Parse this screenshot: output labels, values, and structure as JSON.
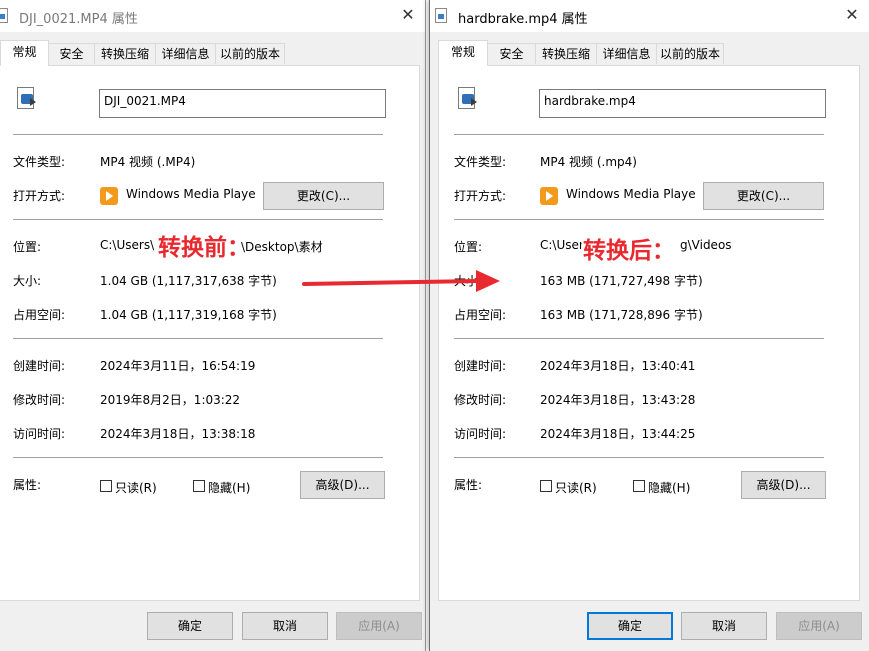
{
  "left": {
    "title": "DJI_0021.MP4 属性",
    "tabs": [
      "常规",
      "安全",
      "转换压缩",
      "详细信息",
      "以前的版本"
    ],
    "filename": "DJI_0021.MP4",
    "labels": {
      "file_type": "文件类型:",
      "open_with": "打开方式:",
      "location": "位置:",
      "size": "大小:",
      "size_on_disk": "占用空间:",
      "created": "创建时间:",
      "modified": "修改时间:",
      "accessed": "访问时间:",
      "attributes": "属性:"
    },
    "file_type": "MP4 视频 (.MP4)",
    "open_with": "Windows Media Playe",
    "change_btn": "更改(C)...",
    "location": "C:\\Users\\",
    "location_tail": "\\Desktop\\素材",
    "size": "1.04 GB (1,117,317,638 字节)",
    "size_on_disk": "1.04 GB (1,117,319,168 字节)",
    "created": "2024年3月11日，16:54:19",
    "modified": "2019年8月2日，1:03:22",
    "accessed": "2024年3月18日，13:38:18",
    "readonly": "只读(R)",
    "hidden": "隐藏(H)",
    "advanced_btn": "高级(D)...",
    "ok": "确定",
    "cancel": "取消",
    "apply": "应用(A)"
  },
  "right": {
    "title": "hardbrake.mp4 属性",
    "tabs": [
      "常规",
      "安全",
      "转换压缩",
      "详细信息",
      "以前的版本"
    ],
    "filename": "hardbrake.mp4",
    "labels": {
      "file_type": "文件类型:",
      "open_with": "打开方式:",
      "location": "位置:",
      "size": "大小:",
      "size_on_disk": "占用空间:",
      "created": "创建时间:",
      "modified": "修改时间:",
      "accessed": "访问时间:",
      "attributes": "属性:"
    },
    "file_type": "MP4 视频 (.mp4)",
    "open_with": "Windows Media Playe",
    "change_btn": "更改(C)...",
    "location": "C:\\User",
    "location_tail": "g\\Videos",
    "size": "163 MB (171,727,498 字节)",
    "size_on_disk": "163 MB (171,728,896 字节)",
    "created": "2024年3月18日，13:40:41",
    "modified": "2024年3月18日，13:43:28",
    "accessed": "2024年3月18日，13:44:25",
    "readonly": "只读(R)",
    "hidden": "隐藏(H)",
    "advanced_btn": "高级(D)...",
    "ok": "确定",
    "cancel": "取消",
    "apply": "应用(A)"
  },
  "annotations": {
    "before": "转换前：",
    "after": "转换后："
  },
  "colors": {
    "annotation_red": "#e8292f",
    "focus_blue": "#0078d7"
  }
}
